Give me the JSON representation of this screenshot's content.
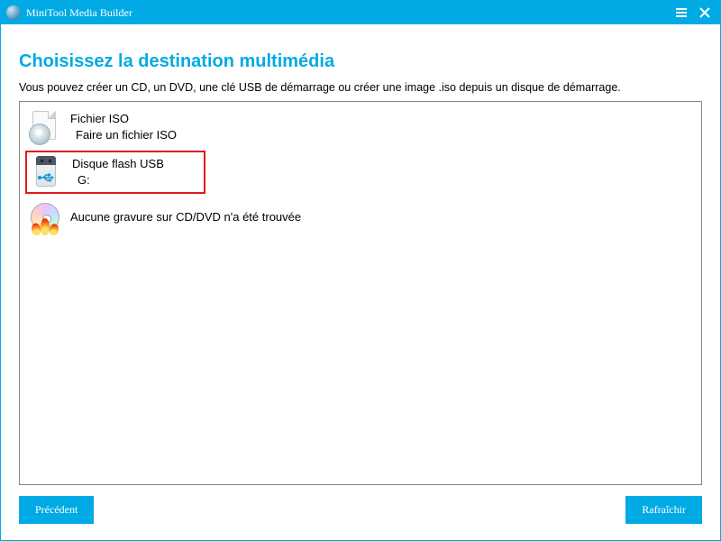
{
  "titlebar": {
    "title": "MiniTool Media Builder"
  },
  "page": {
    "title": "Choisissez la destination multimédia",
    "subtitle": "Vous pouvez créer un CD, un DVD, une clé USB de démarrage ou créer une image .iso depuis un disque de démarrage."
  },
  "options": {
    "iso": {
      "title": "Fichier ISO",
      "sub": "Faire un fichier ISO"
    },
    "usb": {
      "title": "Disque flash USB",
      "sub": "G:"
    },
    "cd": {
      "title": "Aucune gravure sur CD/DVD n'a été trouvée",
      "sub": ""
    }
  },
  "buttons": {
    "back": "Précédent",
    "refresh": "Rafraîchir"
  }
}
